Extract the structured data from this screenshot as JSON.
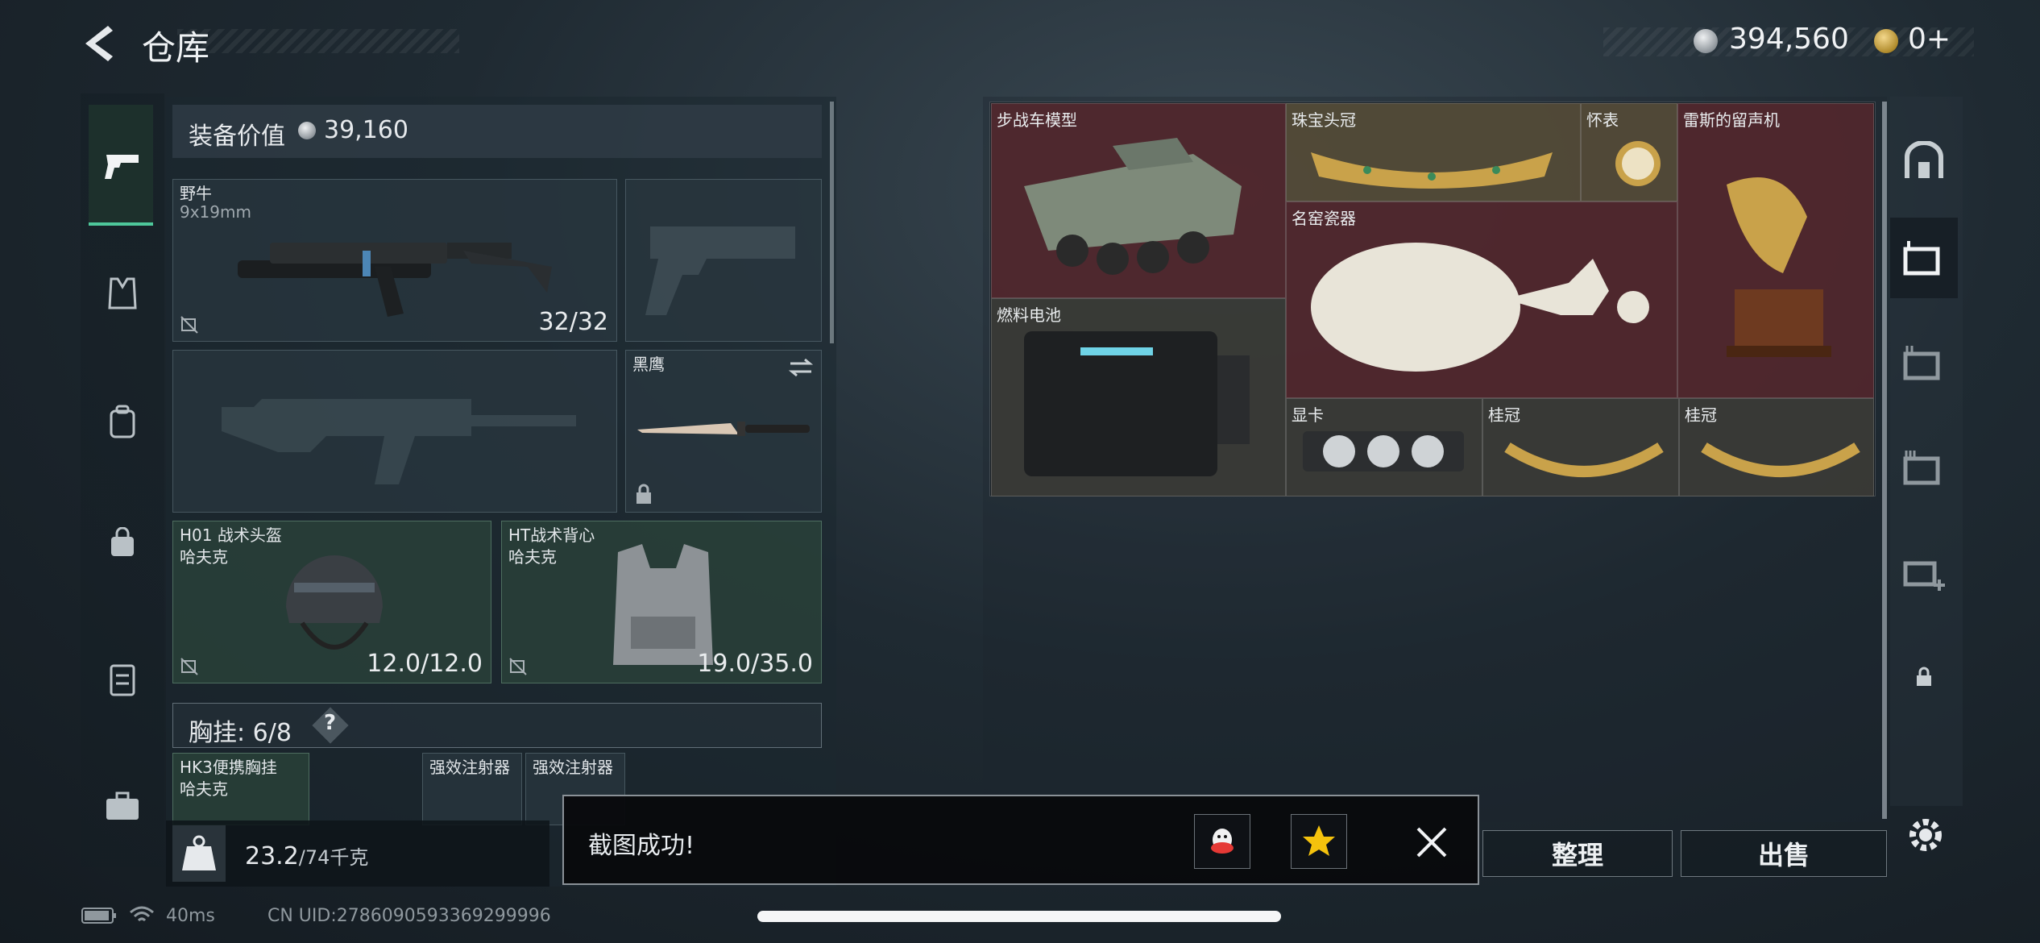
{
  "header": {
    "title": "仓库",
    "currency": "394,560",
    "gold": "0+"
  },
  "equipment": {
    "value_label": "装备价值",
    "value": "39,160",
    "slots": {
      "primary": {
        "name": "野牛",
        "caliber": "9x19mm",
        "count": "32/32"
      },
      "melee": {
        "name": "黑鹰"
      },
      "helmet": {
        "name": "H01 战术头盔",
        "brand": "哈夫克",
        "durability": "12.0/12.0"
      },
      "vest": {
        "name": "HT战术背心",
        "brand": "哈夫克",
        "durability": "19.0/35.0"
      }
    },
    "chest_rig": {
      "label": "胸挂: 6/8",
      "help": "?",
      "items": [
        {
          "name": "HK3便携胸挂",
          "brand": "哈夫克"
        },
        {
          "name": "强效注射器"
        },
        {
          "name": "强效注射器"
        }
      ]
    },
    "weight": {
      "value": "23.2",
      "unit": "/74千克",
      "icon_label": "KG"
    }
  },
  "storage": {
    "items": [
      {
        "name": "步战车模型"
      },
      {
        "name": "珠宝头冠"
      },
      {
        "name": "怀表"
      },
      {
        "name": "雷斯的留声机"
      },
      {
        "name": "名窑瓷器"
      },
      {
        "name": "燃料电池"
      },
      {
        "name": "显卡"
      },
      {
        "name": "桂冠"
      },
      {
        "name": "桂冠"
      }
    ],
    "sort_label": "整理",
    "sell_label": "出售"
  },
  "right_tabs": [
    "vault-icon",
    "storage-1-icon",
    "storage-2-icon",
    "storage-3-icon",
    "add-storage-icon",
    "lock-icon"
  ],
  "toast": {
    "message": "截图成功!"
  },
  "status": {
    "ping": "40ms",
    "uid": "CN UID:2786090593369299996"
  },
  "colors": {
    "accent": "#4ec79b",
    "red_cell": "#5a2a30",
    "gold_item": "#c9a24a"
  }
}
